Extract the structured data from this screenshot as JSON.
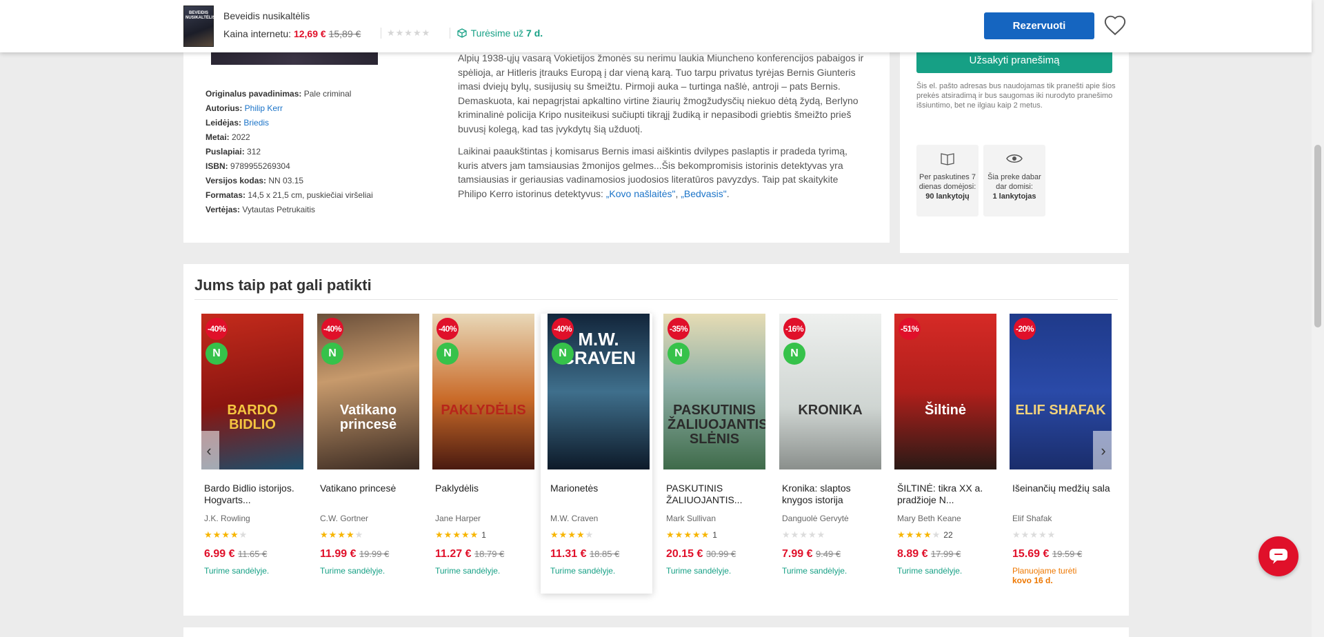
{
  "sticky": {
    "book_title": "Beveidis nusikaltėlis",
    "thumb_text": "BEVEIDIS NUSIKALTĖLIS",
    "price_label": "Kaina internetu: ",
    "price_now": "12,69 €",
    "price_old": "15,89 €",
    "stars": "★★★★★",
    "stock_text": "Turėsime už ",
    "stock_days": "7 d.",
    "reserve_label": "Rezervuoti"
  },
  "specs": [
    {
      "label": "Originalus pavadinimas:",
      "value": "Pale criminal",
      "link": false
    },
    {
      "label": "Autorius:",
      "value": "Philip Kerr",
      "link": true
    },
    {
      "label": "Leidėjas:",
      "value": "Briedis",
      "link": true
    },
    {
      "label": "Metai:",
      "value": "2022",
      "link": false
    },
    {
      "label": "Puslapiai:",
      "value": "312",
      "link": false
    },
    {
      "label": "ISBN:",
      "value": "9789955269304",
      "link": false
    },
    {
      "label": "Versijos kodas:",
      "value": "NN 03.15",
      "link": false
    },
    {
      "label": "Formatas:",
      "value": "14,5 x 21,5 cm, puskiečiai viršeliai",
      "link": false
    },
    {
      "label": "Vertėjas:",
      "value": "Vytautas Petrukaitis",
      "link": false
    }
  ],
  "description": {
    "p1": "Alpių 1938-ųjų vasarą Vokietijos žmonės su nerimu laukia Miuncheno konferencijos pabaigos ir spėlioja, ar Hitleris įtrauks Europą į dar vieną karą. Tuo tarpu privatus tyrėjas Bernis Giunteris imasi dviejų bylų, susijusių su šmeižtu. Pirmoji auka – turtinga našlė, antroji – pats Bernis. Demaskuota, kai nepagrįstai apkaltino virtine žiaurių žmogžudysčių niekuo dėtą žydą, Berlyno kriminalinė policija Kripo nusiteikusi sučiupti tikrąjį žudiką ir nepasibodi griebtis šmeižto prieš buvusį kolegą, kad tas įvykdytų šią užduotį.",
    "p2": "Laikinai paaukštintas į komisarus Bernis imasi aiškintis dvilypes paslaptis ir pradeda tyrimą, kuris atvers jam tamsiausias žmonijos gelmes...Šis bekompromisis istorinis detektyvas yra tamsiausias ir geriausias vadinamosios juodosios literatūros pavyzdys. Taip pat skaitykite Philipo Kerro istorinus detektyvus: ",
    "link1": "„Kovo našlaitės\"",
    "sep": ", ",
    "link2": "„Bedvasis\"",
    "end": "."
  },
  "side": {
    "notify_label": "Užsakyti pranešimą",
    "notice": "Šis el. pašto adresas bus naudojamas tik pranešti apie šios prekės atsiradimą ir bus saugomas iki nurodyto pranešimo išsiuntimo, bet ne ilgiau kaip 2 metus.",
    "stat1_text": "Per paskutines 7 dienas domėjosi:",
    "stat1_value": "90 lankytojų",
    "stat2_text": "Šia preke dabar dar domisi:",
    "stat2_value": "1 lankytojas"
  },
  "recommendations": {
    "heading": "Jums taip pat gali patikti",
    "products": [
      {
        "name": "Bardo Bidlio istorijos. Hogvarts...",
        "author": "J.K. Rowling",
        "discount": "-40%",
        "is_new": true,
        "new_label": "N",
        "rating": 4,
        "rating_count": "",
        "price": "6.99 €",
        "old_price": "11.65 €",
        "availability": "Turime sandėlyje.",
        "cover_text": "BARDO BIDLIO",
        "cover_bg": "linear-gradient(170deg,#c42b1c,#8a1510 55%,#1d4e6b)",
        "cover_color": "#f5c640"
      },
      {
        "name": "Vatikano princesė",
        "author": "C.W. Gortner",
        "discount": "-40%",
        "is_new": true,
        "new_label": "N",
        "rating": 4,
        "rating_count": "",
        "price": "11.99 €",
        "old_price": "19.99 €",
        "availability": "Turime sandėlyje.",
        "cover_text": "Vatikano princesė",
        "cover_bg": "linear-gradient(170deg,#6a4f3a,#c79a6c 40%,#3a2a22)",
        "cover_color": "#ffffff"
      },
      {
        "name": "Paklydėlis",
        "author": "Jane Harper",
        "discount": "-40%",
        "is_new": true,
        "new_label": "N",
        "rating": 5,
        "rating_count": "1",
        "price": "11.27 €",
        "old_price": "18.79 €",
        "availability": "Turime sandėlyje.",
        "cover_text": "PAKLYDĖLIS",
        "cover_bg": "linear-gradient(180deg,#e8d8b8,#c96a28 55%,#4a1a10)",
        "cover_color": "#b8251a"
      },
      {
        "name": "Marionetės",
        "author": "M.W. Craven",
        "discount": "-40%",
        "is_new": true,
        "new_label": "N",
        "rating": 4,
        "rating_count": "",
        "price": "11.31 €",
        "old_price": "18.85 €",
        "availability": "Turime sandėlyje.",
        "cover_text": "M.W. CRAVEN",
        "cover_bg": "linear-gradient(180deg,#12253a,#3f6f8c 50%,#0d1a29)",
        "cover_color": "#ffffff"
      },
      {
        "name": "PASKUTINIS ŽALIUOJANTIS...",
        "author": "Mark Sullivan",
        "discount": "-35%",
        "is_new": true,
        "new_label": "N",
        "rating": 5,
        "rating_count": "1",
        "price": "20.15 €",
        "old_price": "30.99 €",
        "availability": "Turime sandėlyje.",
        "cover_text": "PASKUTINIS ŽALIUOJANTIS SLĖNIS",
        "cover_bg": "linear-gradient(180deg,#e6dcb4,#8fb0a8 45%,#3f6b4a)",
        "cover_color": "#2b2b2b"
      },
      {
        "name": "Kronika: slaptos knygos istorija",
        "author": "Danguolė Gervytė",
        "discount": "-16%",
        "is_new": true,
        "new_label": "N",
        "rating": 0,
        "rating_count": "",
        "price": "7.99 €",
        "old_price": "9.49 €",
        "availability": "Turime sandėlyje.",
        "cover_text": "KRONIKA",
        "cover_bg": "linear-gradient(180deg,#eef0ee,#cfd5d2 60%,#8a8f8c)",
        "cover_color": "#333333"
      },
      {
        "name": "ŠILTINĖ: tikra XX a. pradžioje N...",
        "author": "Mary Beth Keane",
        "discount": "-51%",
        "is_new": false,
        "new_label": "",
        "rating": 4,
        "rating_count": "22",
        "price": "8.89 €",
        "old_price": "17.99 €",
        "availability": "Turime sandėlyje.",
        "cover_text": "Šiltinė",
        "cover_bg": "linear-gradient(180deg,#d62a26,#b01f1b 50%,#2a1a16)",
        "cover_color": "#ffffff"
      },
      {
        "name": "Išeinančių medžių sala",
        "author": "Elif Shafak",
        "discount": "-20%",
        "is_new": false,
        "new_label": "",
        "rating": 0,
        "rating_count": "",
        "price": "15.69 €",
        "old_price": "19.59 €",
        "availability": "Planuojame turėti ",
        "availability_extra": "kovo 16 d.",
        "availability_style": "orange",
        "cover_text": "ELIF SHAFAK",
        "cover_bg": "linear-gradient(180deg,#1f3a8a,#2a4aa8 50%,#1a2d6b)",
        "cover_color": "#f3d37a"
      }
    ],
    "prev_arrow": "‹",
    "next_arrow": "›"
  },
  "colors": {
    "accent_blue": "#1565c0",
    "accent_green": "#16a085",
    "price_red": "#e0102a",
    "new_green": "#36c24a",
    "star_yellow": "#f7b500"
  },
  "icons": [
    "heart-icon",
    "box-icon",
    "star-icon",
    "book-icon",
    "eye-icon",
    "chat-icon",
    "chevron-left-icon",
    "chevron-right-icon"
  ]
}
